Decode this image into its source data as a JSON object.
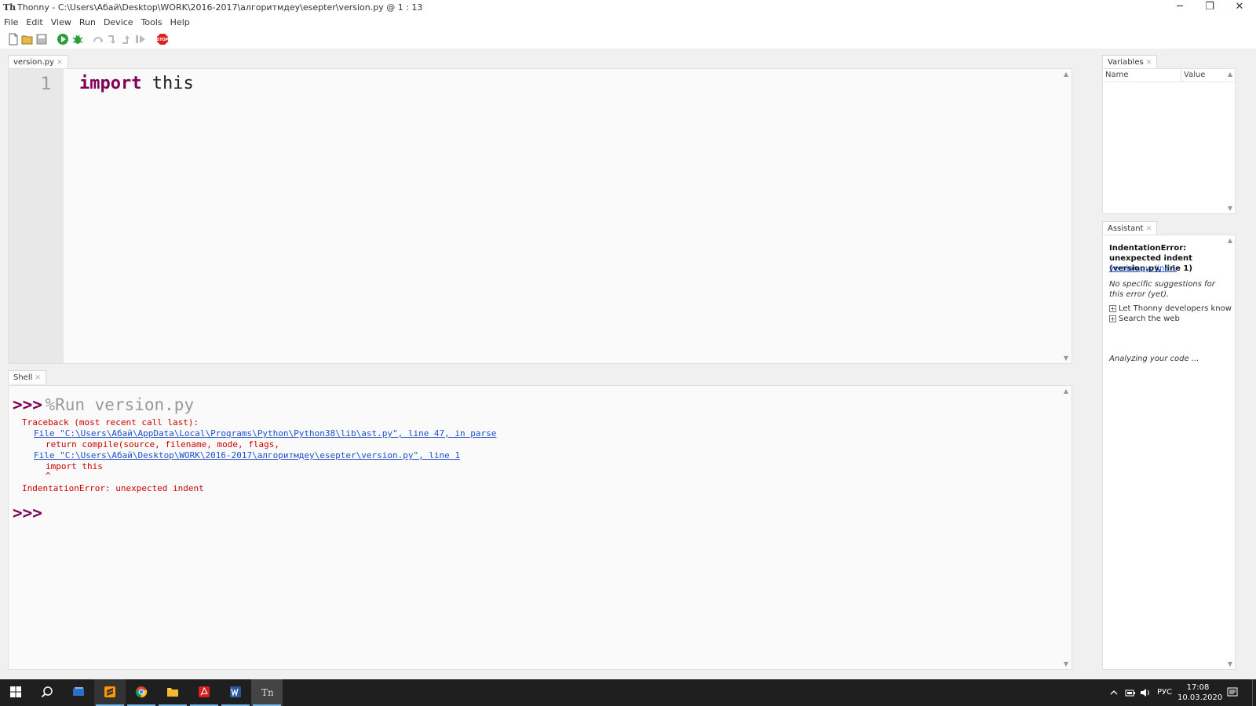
{
  "window": {
    "app_icon_text": "Th",
    "title": "Thonny  -  C:\\Users\\Абай\\Desktop\\WORK\\2016-2017\\алгоритмдеу\\esepter\\version.py  @  1 : 13",
    "minimize": "─",
    "maximize": "❐",
    "close": "✕"
  },
  "menu": [
    "File",
    "Edit",
    "View",
    "Run",
    "Device",
    "Tools",
    "Help"
  ],
  "toolbar": {
    "buttons": [
      "new-file",
      "open-file",
      "save-file",
      "run",
      "debug",
      "step-over",
      "step-into",
      "step-out",
      "resume",
      "stop"
    ],
    "stop_text": "STOP"
  },
  "editor": {
    "tab": "version.py",
    "line_number": "1",
    "keyword": "import",
    "rest": " this"
  },
  "shell": {
    "tab": "Shell",
    "prompt": ">>>",
    "command": "%Run version.py",
    "traceback_header": "Traceback (most recent call last):",
    "file1": "File \"C:\\Users\\Абай\\AppData\\Local\\Programs\\Python\\Python38\\lib\\ast.py\", line 47, in parse",
    "code1": "return compile(source, filename, mode, flags,",
    "file2": "File \"C:\\Users\\Абай\\Desktop\\WORK\\2016-2017\\алгоритмдеу\\esepter\\version.py\", line 1",
    "code2": "import this",
    "caret": "^",
    "error": "IndentationError: unexpected indent",
    "prompt2": ">>>"
  },
  "variables": {
    "tab": "Variables",
    "col_name": "Name",
    "col_value": "Value"
  },
  "assistant": {
    "tab": "Assistant",
    "error_title": "IndentationError: unexpected indent (version.py, line 1)",
    "link": "version.py, line 1",
    "no_suggestions": "No specific suggestions for this error (yet).",
    "item1": "Let Thonny developers know",
    "item2": "Search the web",
    "analyzing": "Analyzing your code ..."
  },
  "taskbar": {
    "apps": [
      "start",
      "search",
      "task-view",
      "sublime-text",
      "chrome",
      "file-explorer",
      "acrobat",
      "word",
      "thonny"
    ],
    "lang": "РУС",
    "time": "17:08",
    "date": "10.03.2020"
  },
  "colors": {
    "keyword": "#7f0055",
    "error": "#cc0000",
    "link": "#1f4fcc",
    "taskbar": "#1f1f1f",
    "active_underline": "#76b9ed"
  }
}
